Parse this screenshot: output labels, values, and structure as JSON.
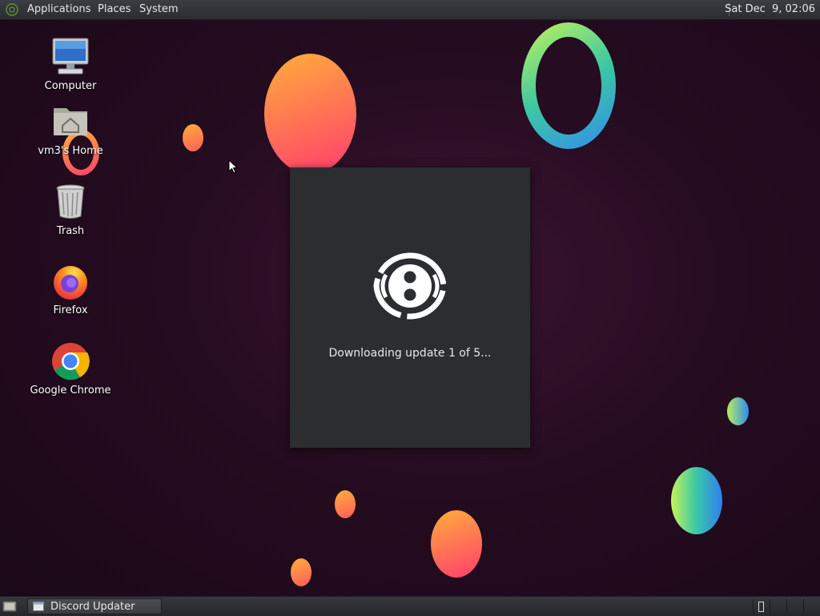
{
  "top_panel": {
    "menus": [
      "Applications",
      "Places",
      "System"
    ],
    "clock": "Sat Dec  9, 02:06"
  },
  "desktop_icons": [
    {
      "label": "Computer",
      "icon": "computer-icon"
    },
    {
      "label": "vm3's Home",
      "icon": "home-folder-icon"
    },
    {
      "label": "Trash",
      "icon": "trash-icon"
    },
    {
      "label": "Firefox",
      "icon": "firefox-icon"
    },
    {
      "label": "Google Chrome",
      "icon": "chrome-icon"
    }
  ],
  "updater": {
    "status": "Downloading update 1 of 5..."
  },
  "taskbar": {
    "tasks": [
      {
        "label": "Discord Updater",
        "icon": "window-icon"
      }
    ]
  },
  "colors": {
    "panel": "#2b2d31",
    "updater_bg": "#2b2d31",
    "desktop_bg": "#250c20"
  }
}
